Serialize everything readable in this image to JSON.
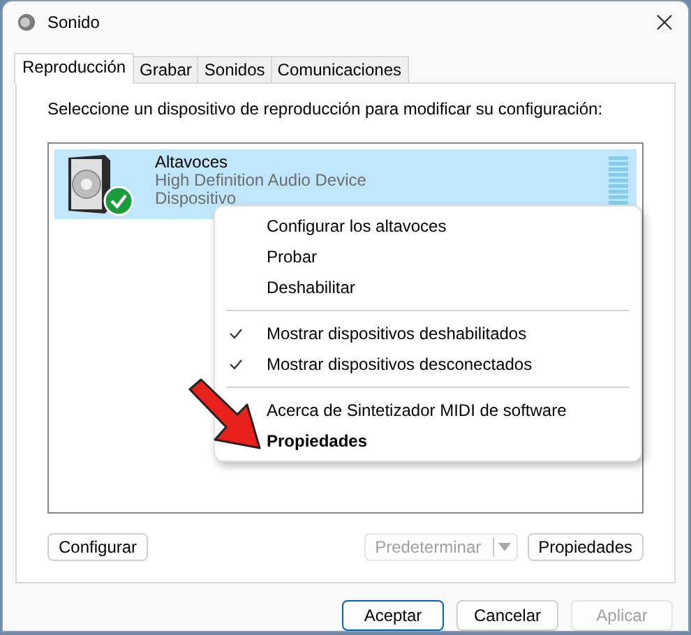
{
  "window": {
    "title": "Sonido"
  },
  "tabs": [
    {
      "label": "Reproducción",
      "selected": true
    },
    {
      "label": "Grabar",
      "selected": false
    },
    {
      "label": "Sonidos",
      "selected": false
    },
    {
      "label": "Comunicaciones",
      "selected": false
    }
  ],
  "instruction": "Seleccione un dispositivo de reproducción para modificar su configuración:",
  "devices": [
    {
      "name": "Altavoces",
      "description": "High Definition Audio Device",
      "status": "Dispositivo",
      "selected": true,
      "is_default": true
    }
  ],
  "context_menu": [
    {
      "kind": "item",
      "label": "Configurar los altavoces",
      "checked": false,
      "default": false
    },
    {
      "kind": "item",
      "label": "Probar",
      "checked": false,
      "default": false
    },
    {
      "kind": "item",
      "label": "Deshabilitar",
      "checked": false,
      "default": false
    },
    {
      "kind": "separator"
    },
    {
      "kind": "item",
      "label": "Mostrar dispositivos deshabilitados",
      "checked": true,
      "default": false
    },
    {
      "kind": "item",
      "label": "Mostrar dispositivos desconectados",
      "checked": true,
      "default": false
    },
    {
      "kind": "separator"
    },
    {
      "kind": "item",
      "label": "Acerca de Sintetizador MIDI de software",
      "checked": false,
      "default": false
    },
    {
      "kind": "item",
      "label": "Propiedades",
      "checked": false,
      "default": true
    }
  ],
  "panel_buttons": {
    "configure": {
      "label": "Configurar",
      "disabled": false
    },
    "set_default": {
      "label": "Predeterminar",
      "disabled": true
    },
    "properties": {
      "label": "Propiedades",
      "disabled": false
    }
  },
  "dialog_buttons": [
    {
      "label": "Aceptar",
      "default": true,
      "disabled": false
    },
    {
      "label": "Cancelar",
      "default": false,
      "disabled": false
    },
    {
      "label": "Aplicar",
      "default": false,
      "disabled": true
    }
  ]
}
